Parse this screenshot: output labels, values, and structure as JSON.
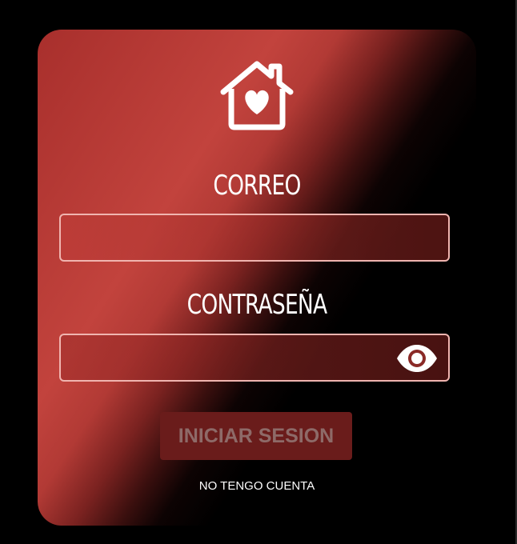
{
  "login": {
    "logo_icon": "house-heart-icon",
    "email_label": "CORREO",
    "email_value": "",
    "password_label": "CONTRASEÑA",
    "password_value": "",
    "password_toggle_icon": "eye-icon",
    "submit_label": "INICIAR SESION",
    "signup_link": "NO TENGO CUENTA"
  },
  "colors": {
    "card_red": "#c2433d",
    "input_border": "#f0b5b0",
    "button_bg": "#6a1c1b",
    "button_text": "#8e6a68",
    "background": "#000000"
  }
}
